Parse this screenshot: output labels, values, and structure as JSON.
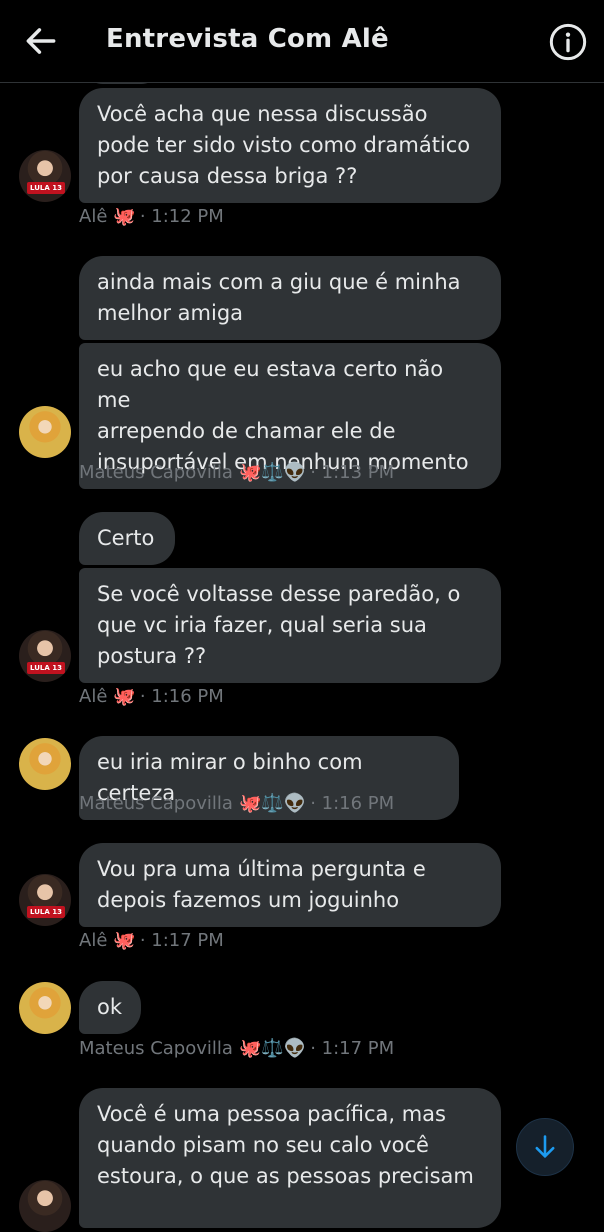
{
  "header": {
    "title": "Entrevista Com Alê",
    "back_icon": "arrow-left-icon",
    "info_icon": "info-icon"
  },
  "messages": [
    {
      "sender": "Alê",
      "text_lines": [
        "Você acha que nessa discussão",
        "pode ter sido visto como dramático",
        "por causa dessa briga ??"
      ]
    },
    {
      "sender": "Mateus Capovilla",
      "text_lines": [
        "ainda mais com a giu que é minha",
        "melhor amiga"
      ]
    },
    {
      "sender": "Mateus Capovilla",
      "text_lines": [
        "eu acho que eu estava certo não me",
        "arrependo de chamar ele de",
        "insuportável em nenhum momento"
      ]
    },
    {
      "sender": "Alê",
      "text_lines": [
        "Certo"
      ]
    },
    {
      "sender": "Alê",
      "text_lines": [
        "Se você voltasse desse paredão, o",
        "que vc iria fazer, qual seria sua",
        "postura ??"
      ]
    },
    {
      "sender": "Mateus Capovilla",
      "text_lines": [
        "eu iria mirar o binho com certeza"
      ]
    },
    {
      "sender": "Alê",
      "text_lines": [
        "Vou pra uma última pergunta e",
        "depois fazemos um joguinho"
      ]
    },
    {
      "sender": "Mateus Capovilla",
      "text_lines": [
        "ok"
      ]
    },
    {
      "sender": "Alê",
      "text_lines": [
        "Você é uma pessoa pacífica, mas",
        "quando pisam no seu calo você",
        "estoura, o que as pessoas precisam"
      ]
    }
  ],
  "meta": [
    {
      "name": "Alê",
      "emoji": "🐙",
      "time": "· 1:12 PM"
    },
    {
      "name": "Mateus Capovilla",
      "emoji": "🐙⚖️👽",
      "time": "· 1:13 PM"
    },
    {
      "name": "Alê",
      "emoji": "🐙",
      "time": "· 1:16 PM"
    },
    {
      "name": "Mateus Capovilla",
      "emoji": "🐙⚖️👽",
      "time": "· 1:16 PM"
    },
    {
      "name": "Alê",
      "emoji": "🐙",
      "time": "· 1:17 PM"
    },
    {
      "name": "Mateus Capovilla",
      "emoji": "🐙⚖️👽",
      "time": "· 1:17 PM"
    }
  ],
  "badges": {
    "lula": "LULA 13"
  },
  "scroll_button_icon": "arrow-down-icon",
  "colors": {
    "bubble": "#2f3336",
    "meta": "#71767b",
    "accent": "#1d9bf0"
  }
}
